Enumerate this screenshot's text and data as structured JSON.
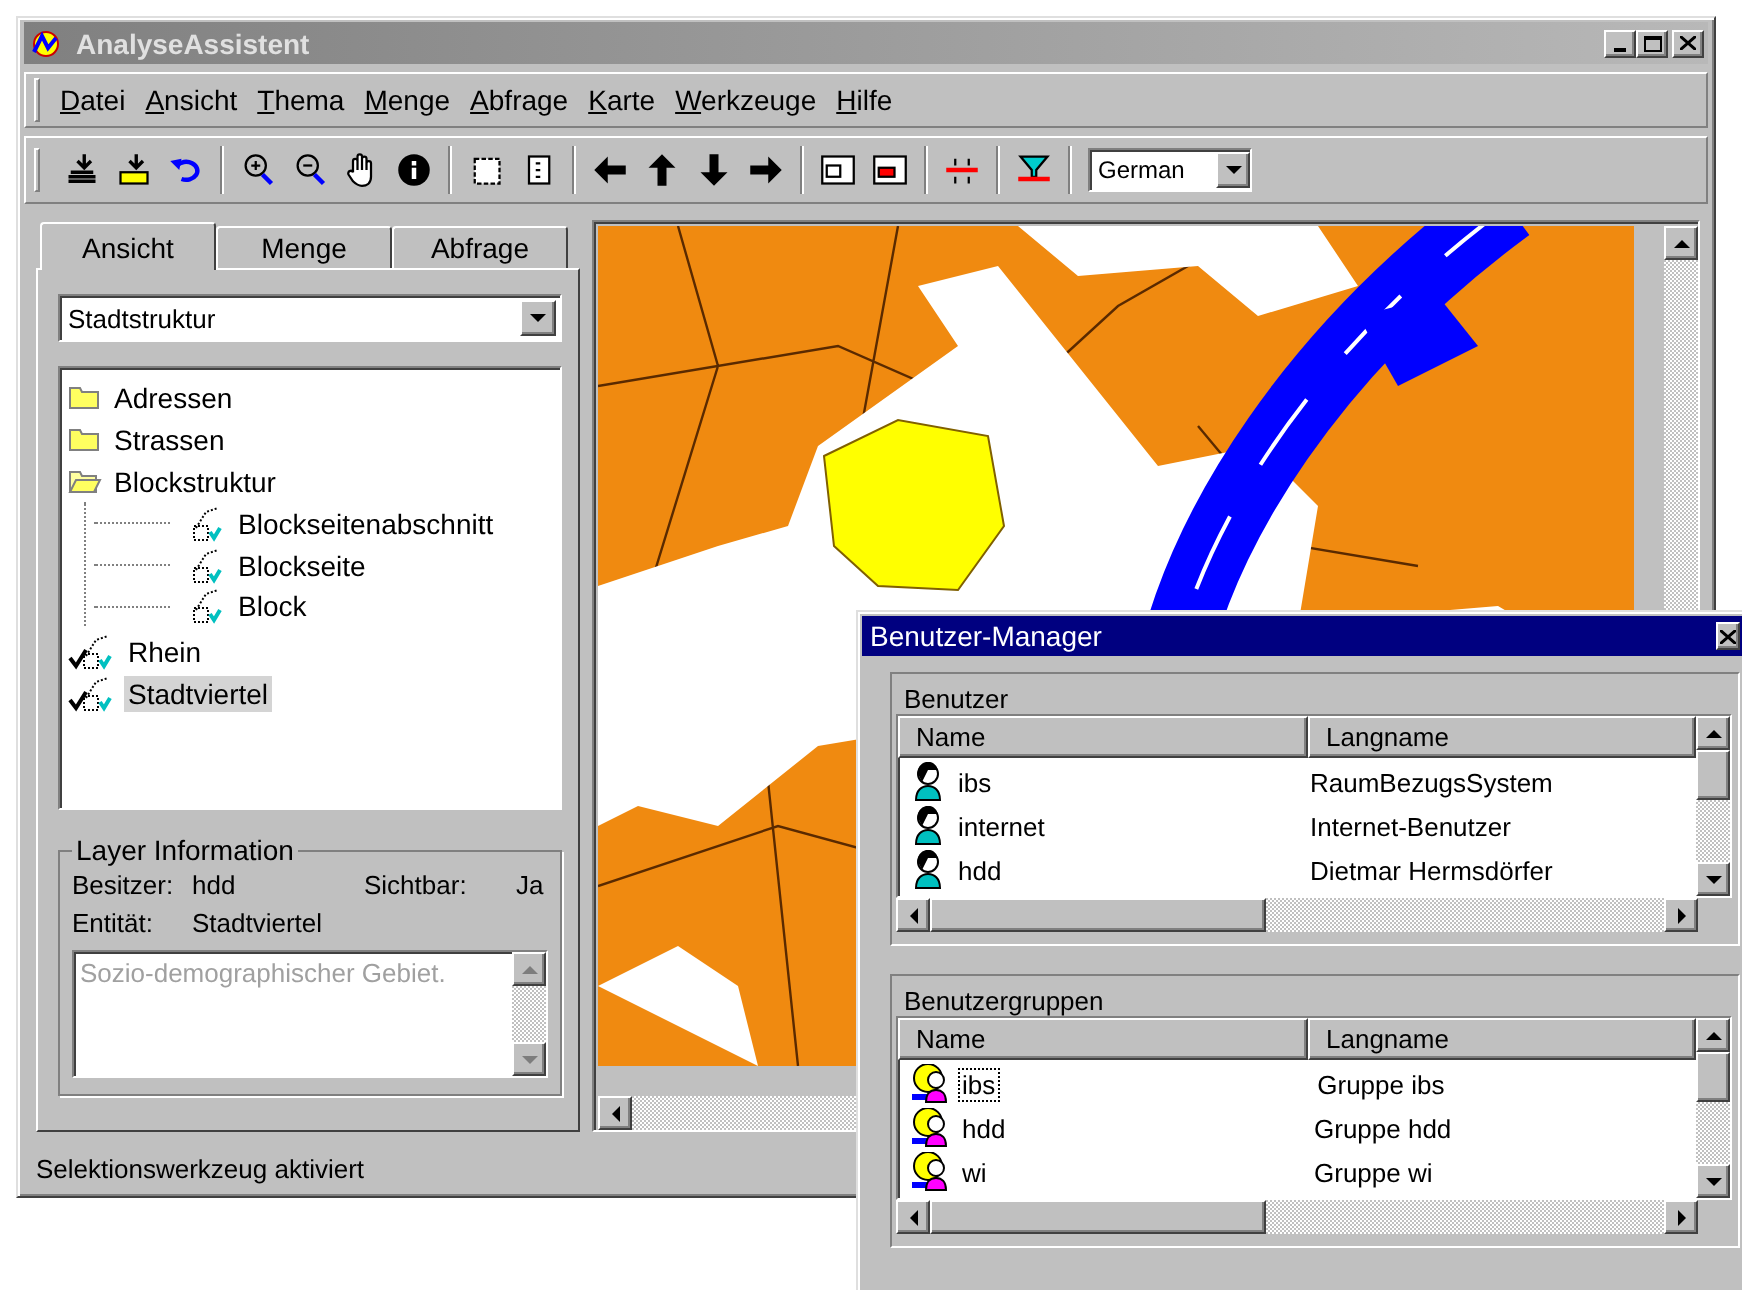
{
  "window": {
    "title": "AnalyseAssistent"
  },
  "menu": [
    "Datei",
    "Ansicht",
    "Thema",
    "Menge",
    "Abfrage",
    "Karte",
    "Werkzeuge",
    "Hilfe"
  ],
  "toolbar": {
    "language": "German"
  },
  "side_panel": {
    "tabs": [
      {
        "label": "Ansicht",
        "selected": true
      },
      {
        "label": "Menge",
        "selected": false
      },
      {
        "label": "Abfrage",
        "selected": false
      }
    ],
    "theme": "Stadtstruktur",
    "tree": [
      {
        "label": "Adressen",
        "kind": "folder",
        "checked": false,
        "selected": false
      },
      {
        "label": "Strassen",
        "kind": "folder",
        "checked": false,
        "selected": false
      },
      {
        "label": "Blockstruktur",
        "kind": "folder",
        "expanded": true,
        "checked": false,
        "selected": false,
        "children": [
          {
            "label": "Blockseitenabschnitt",
            "kind": "layer",
            "checked": false,
            "selected": false
          },
          {
            "label": "Blockseite",
            "kind": "layer",
            "checked": false,
            "selected": false
          },
          {
            "label": "Block",
            "kind": "layer",
            "checked": false,
            "selected": false
          }
        ]
      },
      {
        "label": "Rhein",
        "kind": "layer",
        "checked": true,
        "selected": false
      },
      {
        "label": "Stadtviertel",
        "kind": "layer",
        "checked": true,
        "selected": true
      }
    ],
    "layer_information": {
      "title": "Layer Information",
      "owner_label": "Besitzer:",
      "owner": "hdd",
      "visible_label": "Sichtbar:",
      "visible": "Ja",
      "entity_label": "Entität:",
      "entity": "Stadtviertel",
      "description": "Sozio-demographischer Gebiet."
    }
  },
  "status_bar": "Selektionswerkzeug aktiviert",
  "user_manager": {
    "title": "Benutzer-Manager",
    "sections": [
      {
        "title": "Benutzer",
        "kind": "user",
        "columns": [
          "Name",
          "Langname"
        ],
        "rows": [
          {
            "name": "ibs",
            "full_name": "RaumBezugsSystem",
            "selected": false
          },
          {
            "name": "internet",
            "full_name": "Internet-Benutzer",
            "selected": false
          },
          {
            "name": "hdd",
            "full_name": "Dietmar Hermsdörfer",
            "selected": false
          }
        ]
      },
      {
        "title": "Benutzergruppen",
        "kind": "group",
        "columns": [
          "Name",
          "Langname"
        ],
        "rows": [
          {
            "name": "ibs",
            "full_name": "Gruppe ibs",
            "selected": true
          },
          {
            "name": "hdd",
            "full_name": "Gruppe hdd",
            "selected": false
          },
          {
            "name": "wi",
            "full_name": "Gruppe wi",
            "selected": false
          }
        ]
      }
    ]
  }
}
